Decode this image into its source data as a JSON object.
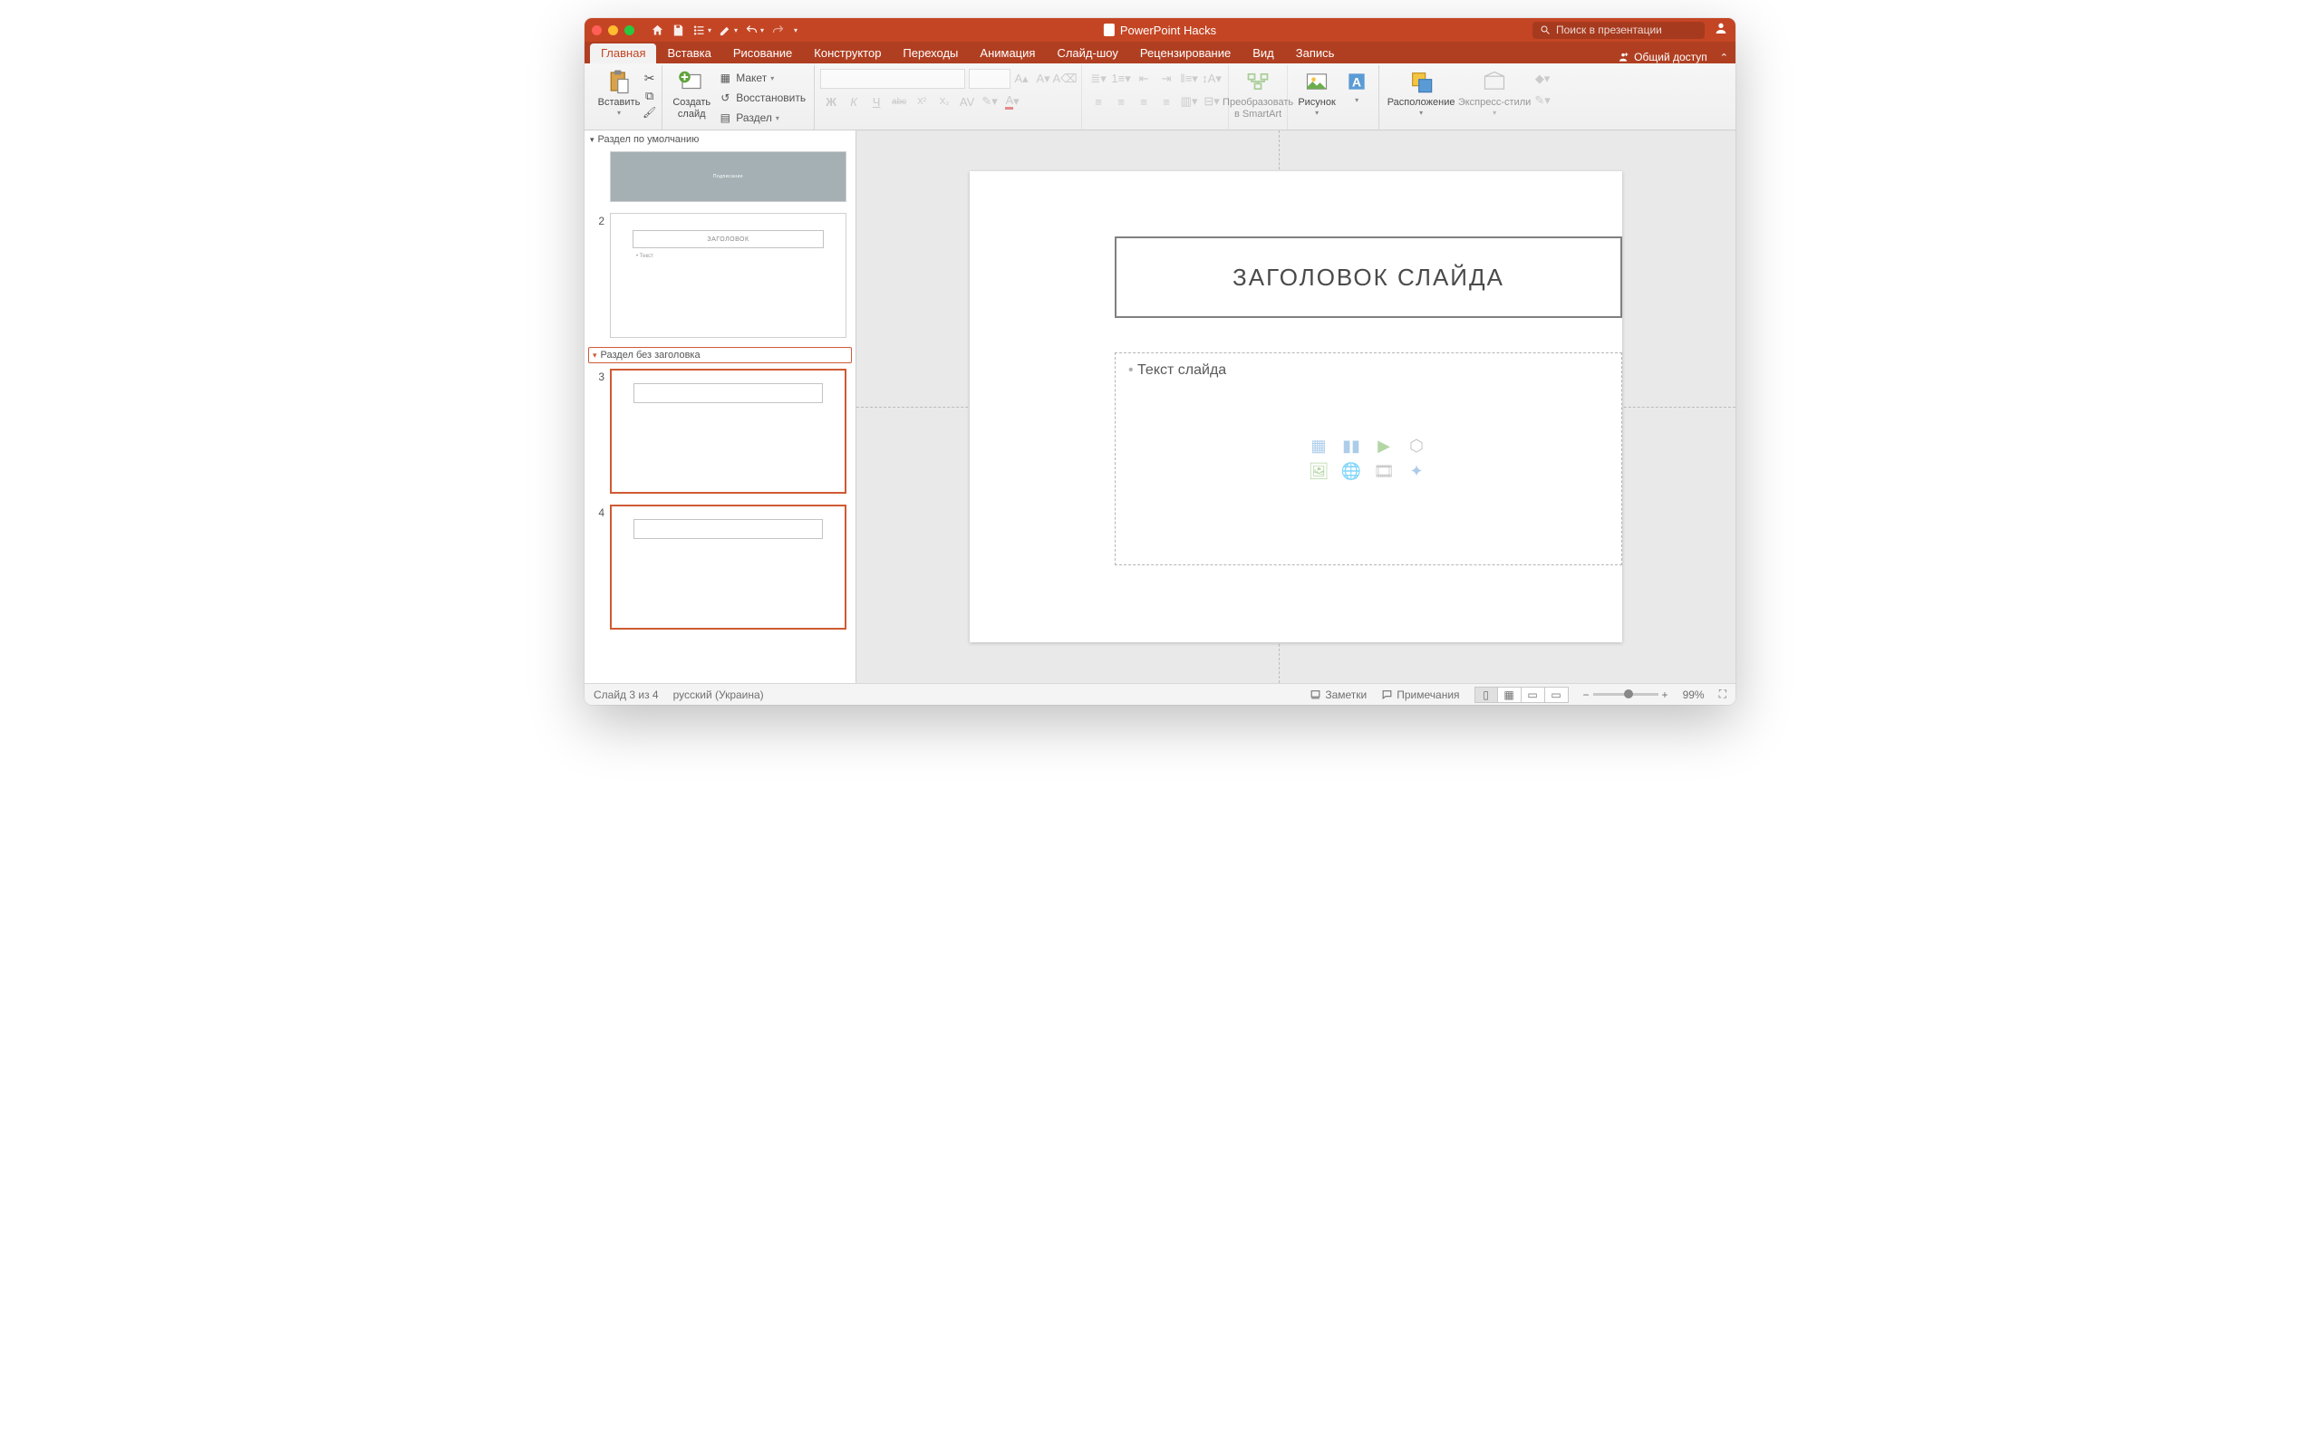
{
  "titlebar": {
    "app_title": "PowerPoint Hacks",
    "search_placeholder": "Поиск в презентации"
  },
  "tabs": {
    "home": "Главная",
    "insert": "Вставка",
    "draw": "Рисование",
    "design": "Конструктор",
    "transitions": "Переходы",
    "animations": "Анимация",
    "slideshow": "Слайд-шоу",
    "review": "Рецензирование",
    "view": "Вид",
    "record": "Запись",
    "share": "Общий доступ"
  },
  "ribbon": {
    "paste": "Вставить",
    "new_slide": "Создать\nслайд",
    "layout": "Макет",
    "reset": "Восстановить",
    "section": "Раздел",
    "convert_smartart": "Преобразовать\nв SmartArt",
    "picture": "Рисунок",
    "arrange": "Расположение",
    "quick_styles": "Экспресс-стили",
    "font_letters": {
      "bold": "Ж",
      "italic": "К",
      "underline": "Ч",
      "strike": "abc",
      "sup": "X²",
      "sub": "X₂"
    }
  },
  "sections": {
    "default": "Раздел по умолчанию",
    "untitled": "Раздел без заголовка"
  },
  "thumbs": {
    "n2": "2",
    "n3": "3",
    "n4": "4",
    "t1_title": "Подписание",
    "t2_title": "ЗАГОЛОВОК",
    "t2_body": "Текст"
  },
  "slide": {
    "title": "ЗАГОЛОВОК СЛАЙДА",
    "body": "Текст слайда"
  },
  "statusbar": {
    "slide_of": "Слайд 3 из 4",
    "lang": "русский (Украина)",
    "notes": "Заметки",
    "comments": "Примечания",
    "zoom": "99%"
  }
}
